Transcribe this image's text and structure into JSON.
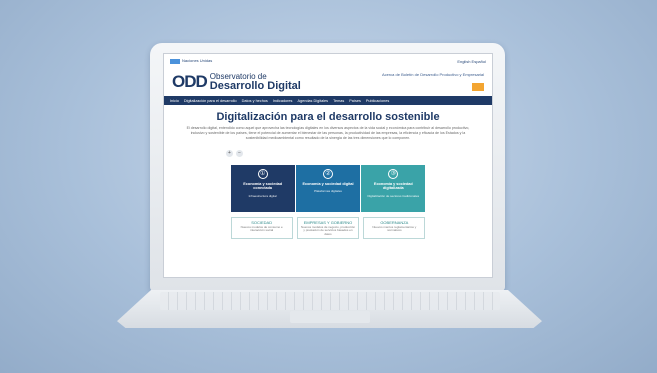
{
  "topstrip": {
    "un_label": "Naciones Unidas",
    "lang": "English   Español"
  },
  "header": {
    "logo_mark": "ODD",
    "logo_line1": "Observatorio de",
    "logo_line2": "Desarrollo Digital",
    "link_text": "Acerca de   Boletín de Desarrollo Productivo y Empresarial"
  },
  "nav": [
    "Inicio",
    "Digitalización para el desarrollo",
    "Datos y hechos",
    "Indicadores",
    "Agendas Digitales",
    "Temas",
    "Países",
    "Publicaciones"
  ],
  "hero": {
    "title": "Digitalización para el desarrollo sostenible",
    "text": "El desarrollo digital, entendido como aquel que aprovecha las tecnologías digitales en los diversos aspectos de la vida social y económica para contribuir al desarrollo productivo, inclusivo y sostenible de los países, tiene el potencial de aumentar el bienestar de las personas, la productividad de las empresas, la eficiencia y eficacia de los Estados y la sostenibilidad medioambiental como resultado de la sinergia de las tres dimensiones que lo componen."
  },
  "zoom": [
    "+",
    "−"
  ],
  "cards": [
    {
      "icon": "①",
      "title": "Economía y sociedad conectada",
      "sub": "Infraestructura digital",
      "color": "#1f3a66"
    },
    {
      "icon": "②",
      "title": "Economía y sociedad digital",
      "sub": "Plataformas digitales",
      "color": "#1e6fa3"
    },
    {
      "icon": "③",
      "title": "Economía y sociedad digitalizada",
      "sub": "Digitalización de sectores tradicionales",
      "color": "#3aa3a8"
    }
  ],
  "subcards": [
    {
      "title": "SOCIEDAD",
      "sub": "Nuevos modelos de consumo e interacción social"
    },
    {
      "title": "EMPRESAS Y GOBIERNO",
      "sub": "Nuevos modelos de negocio, producción y prestación de servicios basados en datos"
    },
    {
      "title": "GOBERNANZA",
      "sub": "Nuevos marcos reglamentarios y normativos"
    }
  ]
}
